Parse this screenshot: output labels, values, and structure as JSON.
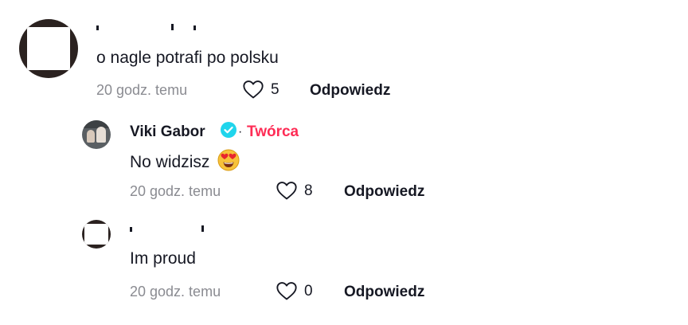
{
  "comments": [
    {
      "username": "",
      "text": "o nagle potrafi po polsku",
      "time": "20 godz. temu",
      "likes": "5",
      "reply_label": "Odpowiedz"
    },
    {
      "username": "Viki Gabor",
      "verified": true,
      "separator": "·",
      "badge": "Twórca",
      "text": "No widzisz",
      "emoji": "heart-eyes-emoji",
      "time": "20 godz. temu",
      "likes": "8",
      "reply_label": "Odpowiedz"
    },
    {
      "username": "",
      "text": "Im proud",
      "time": "20 godz. temu",
      "likes": "0",
      "reply_label": "Odpowiedz"
    }
  ],
  "colors": {
    "creator_badge": "#fe2c55",
    "verified": "#20d5ec",
    "meta": "#8a8b91"
  }
}
